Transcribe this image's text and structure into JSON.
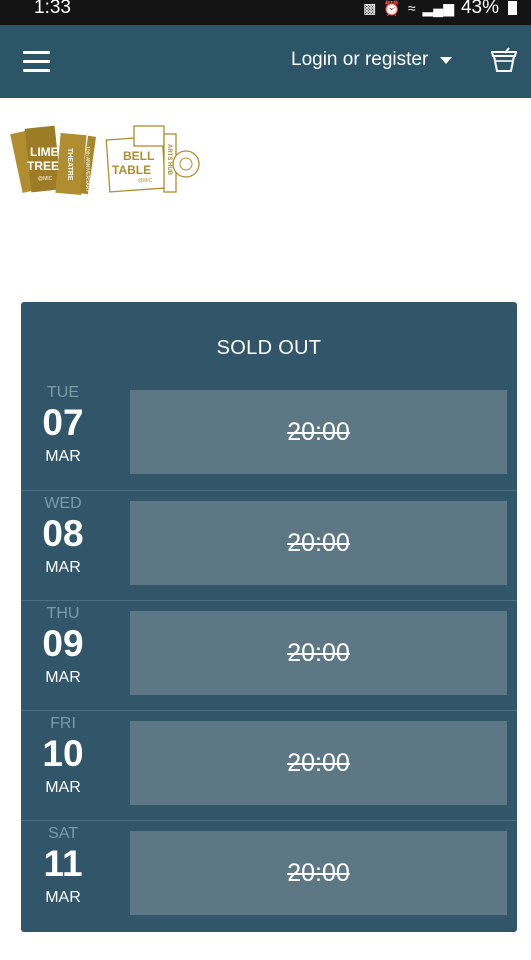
{
  "status_bar": {
    "time": "1:33",
    "battery": "43%"
  },
  "header": {
    "login_label": "Login or register"
  },
  "logos": {
    "lime_tree": {
      "line1": "LIME",
      "line2": "TREE",
      "sub": "@MIC",
      "side1": "THEATRE",
      "side2": "10th ANNIVERSARY"
    },
    "bell_table": {
      "line1": "BELL",
      "line2": "TABLE",
      "sub": "@MIC",
      "side": "ARTS HUB"
    }
  },
  "panel": {
    "title": "SOLD OUT",
    "dates": [
      {
        "dow": "TUE",
        "day": "07",
        "month": "MAR",
        "time": "20:00"
      },
      {
        "dow": "WED",
        "day": "08",
        "month": "MAR",
        "time": "20:00"
      },
      {
        "dow": "THU",
        "day": "09",
        "month": "MAR",
        "time": "20:00"
      },
      {
        "dow": "FRI",
        "day": "10",
        "month": "MAR",
        "time": "20:00"
      },
      {
        "dow": "SAT",
        "day": "11",
        "month": "MAR",
        "time": "20:00"
      }
    ]
  },
  "colors": {
    "header": "#2c5568",
    "panel": "#315669",
    "time_button": "#5d7884",
    "logo_gold": "#b08d2e"
  }
}
